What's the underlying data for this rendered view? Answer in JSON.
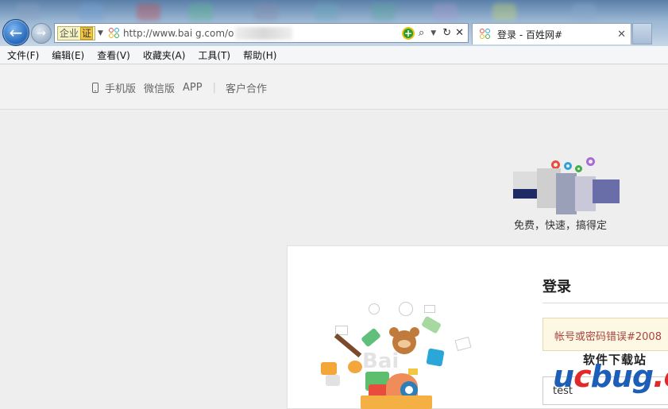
{
  "browser": {
    "address": {
      "cert_label": "企业",
      "cert_badge": "证",
      "url": "http://www.bai  g.com/o"
    },
    "tab": {
      "title": "登录 - 百姓网#",
      "close": "✕"
    },
    "menu": [
      "文件(F)",
      "编辑(E)",
      "查看(V)",
      "收藏夹(A)",
      "工具(T)",
      "帮助(H)"
    ]
  },
  "page": {
    "topnav": {
      "mobile": "手机版",
      "wechat": "微信版",
      "app": "APP",
      "sep": "|",
      "partner": "客户合作"
    },
    "slogan": "免费，快速，搞得定",
    "login": {
      "title": "登录",
      "error": "帐号或密码错误#2008",
      "username_value": "test"
    },
    "watermark": {
      "top": "软件下载站",
      "u": "u",
      "c": "c",
      "rest": "bug",
      "dot": ".cc"
    }
  },
  "colors": {
    "error_text": "#a94442",
    "error_bg": "#fcf8e3",
    "wm_blue": "#1d5fb8",
    "wm_red": "#e02a2a"
  }
}
